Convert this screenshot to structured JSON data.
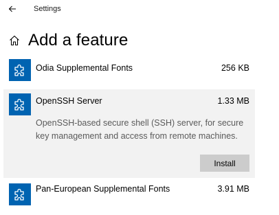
{
  "window": {
    "title": "Settings"
  },
  "page": {
    "title": "Add a feature"
  },
  "features": [
    {
      "name": "Odia Supplemental Fonts",
      "size": "256 KB"
    },
    {
      "name": "OpenSSH Server",
      "size": "1.33 MB",
      "description": "OpenSSH-based secure shell (SSH) server, for secure key management and access from remote machines.",
      "action_label": "Install"
    },
    {
      "name": "Pan-European Supplemental Fonts",
      "size": "3.91 MB"
    }
  ],
  "colors": {
    "icon_background": "#0063b1",
    "selected_background": "#f2f2f2",
    "button_background": "#cccccc",
    "description_text": "#5a5a5a"
  },
  "icons": {
    "back": "arrow-left-icon",
    "home": "home-icon",
    "feature": "puzzle-piece-icon"
  }
}
